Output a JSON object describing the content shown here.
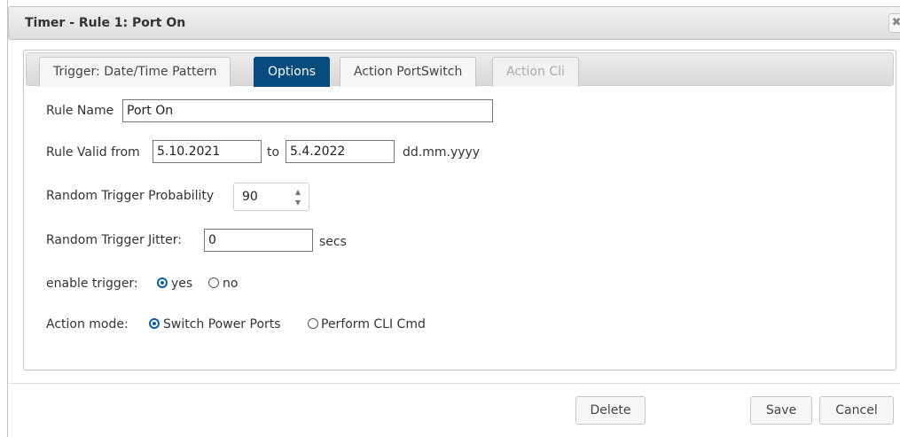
{
  "dialog": {
    "title": "Timer - Rule 1: Port On",
    "close_label": "✖"
  },
  "tabs": [
    {
      "label": "Trigger: Date/Time Pattern",
      "state": "normal"
    },
    {
      "label": "Options",
      "state": "active"
    },
    {
      "label": "Action PortSwitch",
      "state": "normal"
    },
    {
      "label": "Action Cli",
      "state": "disabled"
    }
  ],
  "form": {
    "rule_name_label": "Rule Name",
    "rule_name_value": "Port On",
    "valid_from_label": "Rule Valid from",
    "valid_from_value": "5.10.2021",
    "to_label": "to",
    "valid_to_value": "5.4.2022",
    "date_format_hint": "dd.mm.yyyy",
    "probability_label": "Random Trigger Probability",
    "probability_value": "90",
    "jitter_label": "Random Trigger Jitter:",
    "jitter_value": "0",
    "jitter_unit": "secs",
    "enable_trigger_label": "enable trigger:",
    "enable_yes_label": "yes",
    "enable_no_label": "no",
    "enable_selected": "yes",
    "action_mode_label": "Action mode:",
    "action_switch_label": "Switch Power Ports",
    "action_cli_label": "Perform CLI Cmd",
    "action_selected": "Switch Power Ports"
  },
  "buttons": {
    "delete_label": "Delete",
    "save_label": "Save",
    "cancel_label": "Cancel"
  },
  "colors": {
    "active_tab": "#064c7e",
    "radio_checked": "#0a5eab"
  }
}
